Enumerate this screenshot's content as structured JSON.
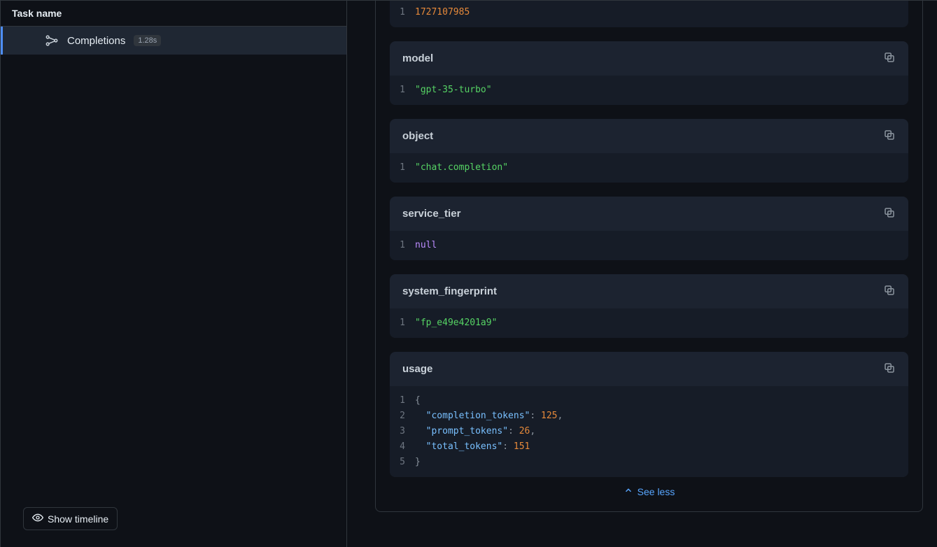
{
  "sidebar": {
    "header": "Task name",
    "task": {
      "label": "Completions",
      "duration": "1.28s"
    },
    "show_timeline": "Show timeline"
  },
  "top_snippet": {
    "line": "1",
    "value": "1727107985"
  },
  "cards": {
    "model": {
      "title": "model",
      "line": "1",
      "value": "\"gpt-35-turbo\""
    },
    "object": {
      "title": "object",
      "line": "1",
      "value": "\"chat.completion\""
    },
    "service_tier": {
      "title": "service_tier",
      "line": "1",
      "value": "null"
    },
    "system_fingerprint": {
      "title": "system_fingerprint",
      "line": "1",
      "value": "\"fp_e49e4201a9\""
    },
    "usage": {
      "title": "usage",
      "lines": {
        "l1": "1",
        "l2": "2",
        "l3": "3",
        "l4": "4",
        "l5": "5",
        "open": "{",
        "k1": "\"completion_tokens\"",
        "v1": "125",
        "k2": "\"prompt_tokens\"",
        "v2": "26",
        "k3": "\"total_tokens\"",
        "v3": "151",
        "close": "}",
        "colon": ": ",
        "comma": ","
      }
    }
  },
  "see_less": "See less"
}
